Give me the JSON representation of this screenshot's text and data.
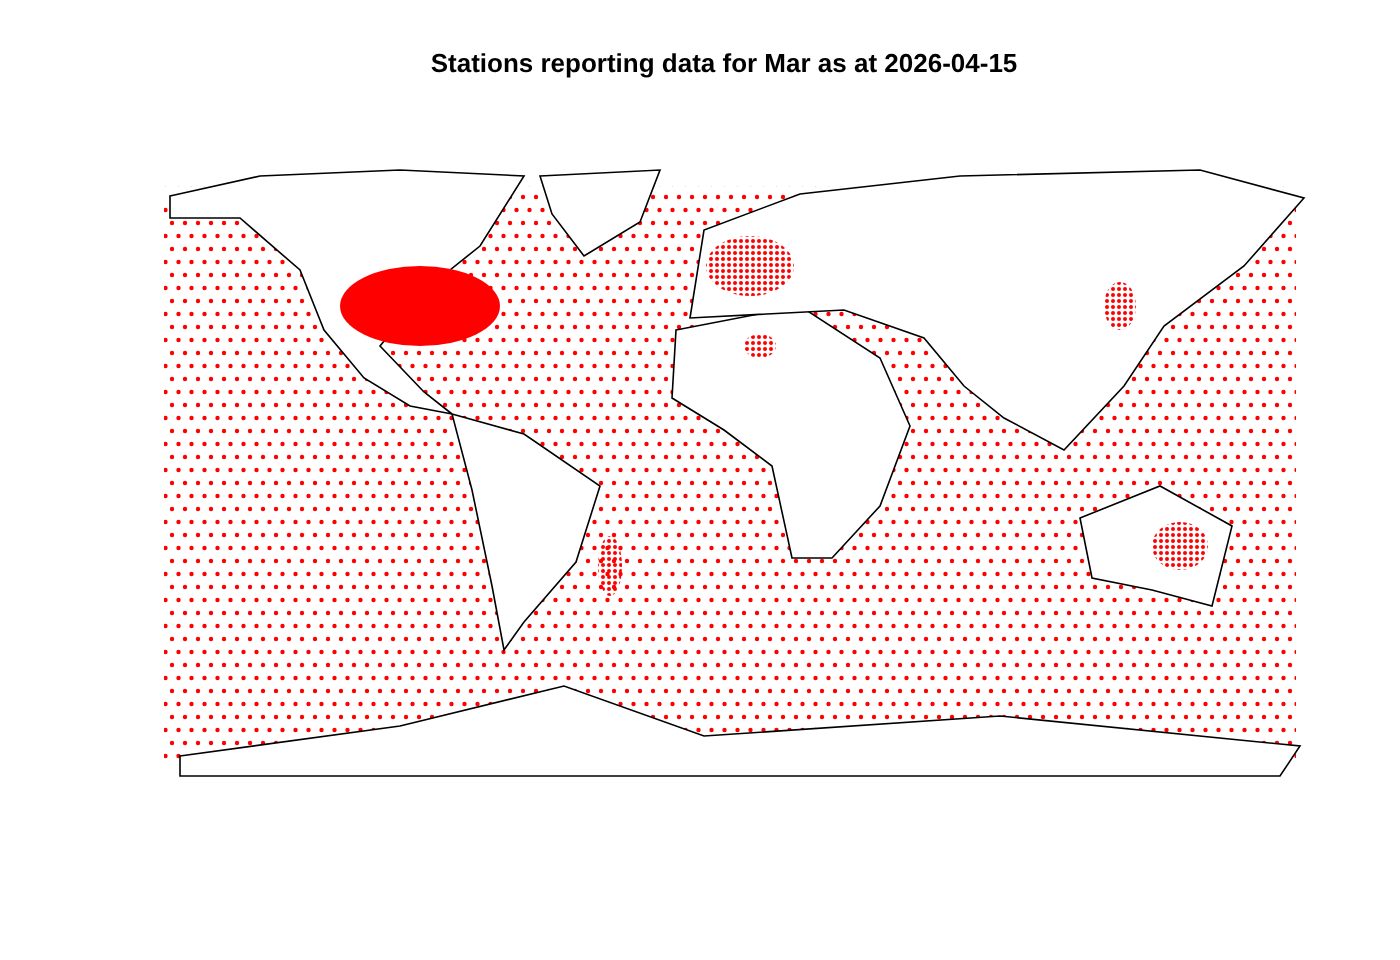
{
  "plot": {
    "title": "Stations reporting data for Mar as at 2026-04-15"
  }
}
